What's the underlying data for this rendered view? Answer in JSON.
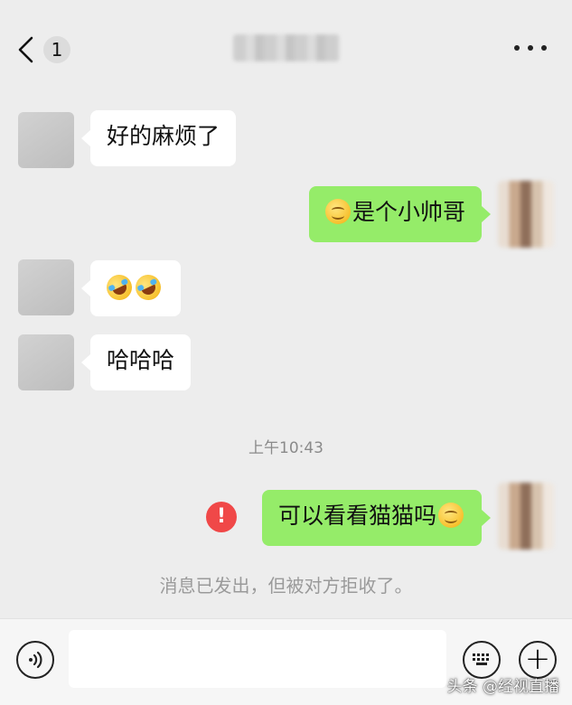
{
  "header": {
    "unread_count": "1"
  },
  "messages": [
    {
      "side": "in",
      "text": "好的麻烦了"
    },
    {
      "side": "out",
      "text": "是个小帅哥",
      "emoji": "smile"
    },
    {
      "side": "in",
      "emoji": "laugh-cry",
      "emoji_count": 2
    },
    {
      "side": "in",
      "text": "哈哈哈"
    },
    {
      "side": "out",
      "text": "可以看看猫猫吗",
      "emoji": "smile",
      "status": "failed"
    }
  ],
  "timestamp": "上午10:43",
  "error_mark": "!",
  "system_note": "消息已发出，但被对方拒收了。",
  "input_bar": {
    "value": "",
    "plus_glyph": "+"
  },
  "watermark": "头条 @经视直播",
  "colors": {
    "background": "#ededed",
    "incoming_bubble": "#ffffff",
    "outgoing_bubble": "#95ec69",
    "error": "#f04848"
  }
}
